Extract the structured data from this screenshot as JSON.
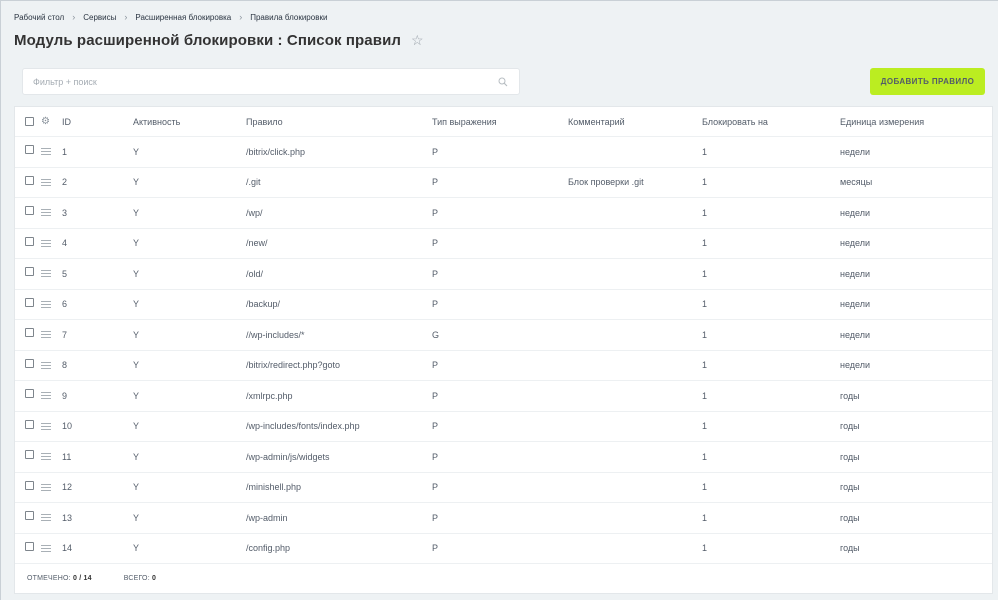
{
  "breadcrumbs": [
    "Рабочий стол",
    "Сервисы",
    "Расширенная блокировка",
    "Правила блокировки"
  ],
  "page_title": "Модуль расширенной блокировки : Список правил",
  "search": {
    "placeholder": "Фильтр + поиск",
    "value": ""
  },
  "add_button_label": "ДОБАВИТЬ ПРАВИЛО",
  "columns": {
    "id": "ID",
    "active": "Активность",
    "rule": "Правило",
    "type": "Тип выражения",
    "comment": "Комментарий",
    "block": "Блокировать на",
    "unit": "Единица измерения"
  },
  "rows": [
    {
      "id": "1",
      "active": "Y",
      "rule": "/bitrix/click.php",
      "type": "P",
      "comment": "",
      "block": "1",
      "unit": "недели"
    },
    {
      "id": "2",
      "active": "Y",
      "rule": "/.git",
      "type": "P",
      "comment": "Блок проверки .git",
      "block": "1",
      "unit": "месяцы"
    },
    {
      "id": "3",
      "active": "Y",
      "rule": "/wp/",
      "type": "P",
      "comment": "",
      "block": "1",
      "unit": "недели"
    },
    {
      "id": "4",
      "active": "Y",
      "rule": "/new/",
      "type": "P",
      "comment": "",
      "block": "1",
      "unit": "недели"
    },
    {
      "id": "5",
      "active": "Y",
      "rule": "/old/",
      "type": "P",
      "comment": "",
      "block": "1",
      "unit": "недели"
    },
    {
      "id": "6",
      "active": "Y",
      "rule": "/backup/",
      "type": "P",
      "comment": "",
      "block": "1",
      "unit": "недели"
    },
    {
      "id": "7",
      "active": "Y",
      "rule": "//wp-includes/*",
      "type": "G",
      "comment": "",
      "block": "1",
      "unit": "недели"
    },
    {
      "id": "8",
      "active": "Y",
      "rule": "/bitrix/redirect.php?goto",
      "type": "P",
      "comment": "",
      "block": "1",
      "unit": "недели"
    },
    {
      "id": "9",
      "active": "Y",
      "rule": "/xmlrpc.php",
      "type": "P",
      "comment": "",
      "block": "1",
      "unit": "годы"
    },
    {
      "id": "10",
      "active": "Y",
      "rule": "/wp-includes/fonts/index.php",
      "type": "P",
      "comment": "",
      "block": "1",
      "unit": "годы"
    },
    {
      "id": "11",
      "active": "Y",
      "rule": "/wp-admin/js/widgets",
      "type": "P",
      "comment": "",
      "block": "1",
      "unit": "годы"
    },
    {
      "id": "12",
      "active": "Y",
      "rule": "/minishell.php",
      "type": "P",
      "comment": "",
      "block": "1",
      "unit": "годы"
    },
    {
      "id": "13",
      "active": "Y",
      "rule": "/wp-admin",
      "type": "P",
      "comment": "",
      "block": "1",
      "unit": "годы"
    },
    {
      "id": "14",
      "active": "Y",
      "rule": "/config.php",
      "type": "P",
      "comment": "",
      "block": "1",
      "unit": "годы"
    }
  ],
  "footer": {
    "checked_label": "ОТМЕЧЕНО:",
    "checked_value": "0 / 14",
    "total_label": "ВСЕГО:",
    "total_value": "0"
  },
  "colors": {
    "accent": "#bbed21",
    "background": "#eef2f4"
  }
}
